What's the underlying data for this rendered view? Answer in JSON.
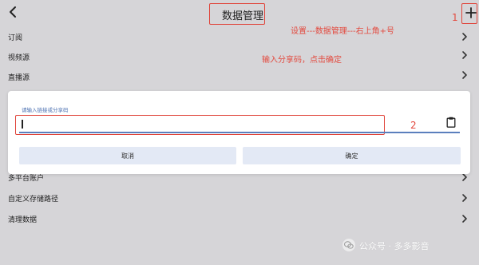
{
  "header": {
    "title": "数据管理",
    "back_icon": "chevron-left-icon",
    "add_icon": "plus-icon"
  },
  "annotations": {
    "step1": "1",
    "step2": "2",
    "path_note": "设置---数据管理---右上角+号",
    "input_note": "输入分享码，点击确定"
  },
  "list": {
    "items": [
      {
        "label": "订阅"
      },
      {
        "label": "视频源"
      },
      {
        "label": "直播源"
      },
      {
        "label": "多平台账户"
      },
      {
        "label": "自定义存储路径"
      },
      {
        "label": "清理数据"
      }
    ]
  },
  "dialog": {
    "field_label": "请输入链接或分享码",
    "field_value": "",
    "clipboard_icon": "clipboard-icon",
    "cancel_label": "取消",
    "confirm_label": "确定"
  },
  "watermark": {
    "text": "公众号 · 多多影音"
  },
  "colors": {
    "background": "#d6d5d8",
    "annotation_red": "#e34a3f",
    "accent_blue": "#4a6fb1",
    "button_bg": "#e3e9f5"
  }
}
